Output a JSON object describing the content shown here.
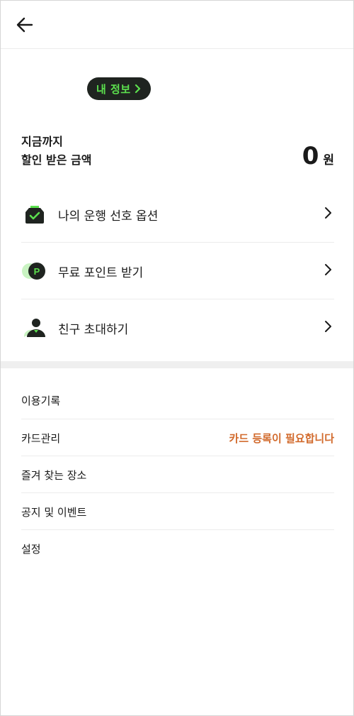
{
  "header": {
    "back_icon": "arrow-left-icon"
  },
  "profile": {
    "my_info_label": "내 정보",
    "my_info_icon": "chevron-right-icon"
  },
  "savings": {
    "line1": "지금까지",
    "line2": "할인 받은 금액",
    "amount": "0",
    "unit": "원"
  },
  "menu": {
    "items": [
      {
        "label": "나의 운행 선호 옵션",
        "icon": "car-seat-check-icon"
      },
      {
        "label": "무료 포인트 받기",
        "icon": "point-coin-icon"
      },
      {
        "label": "친구 초대하기",
        "icon": "person-icon"
      }
    ]
  },
  "list": {
    "items": [
      {
        "label": "이용기록"
      },
      {
        "label": "카드관리",
        "status": "카드 등록이 필요합니다"
      },
      {
        "label": "즐겨 찾는 장소"
      },
      {
        "label": "공지 및 이벤트"
      },
      {
        "label": "설정"
      }
    ]
  },
  "colors": {
    "accent_green": "#5ce04e",
    "dark": "#1f2420",
    "warning_orange": "#d26a2c"
  }
}
